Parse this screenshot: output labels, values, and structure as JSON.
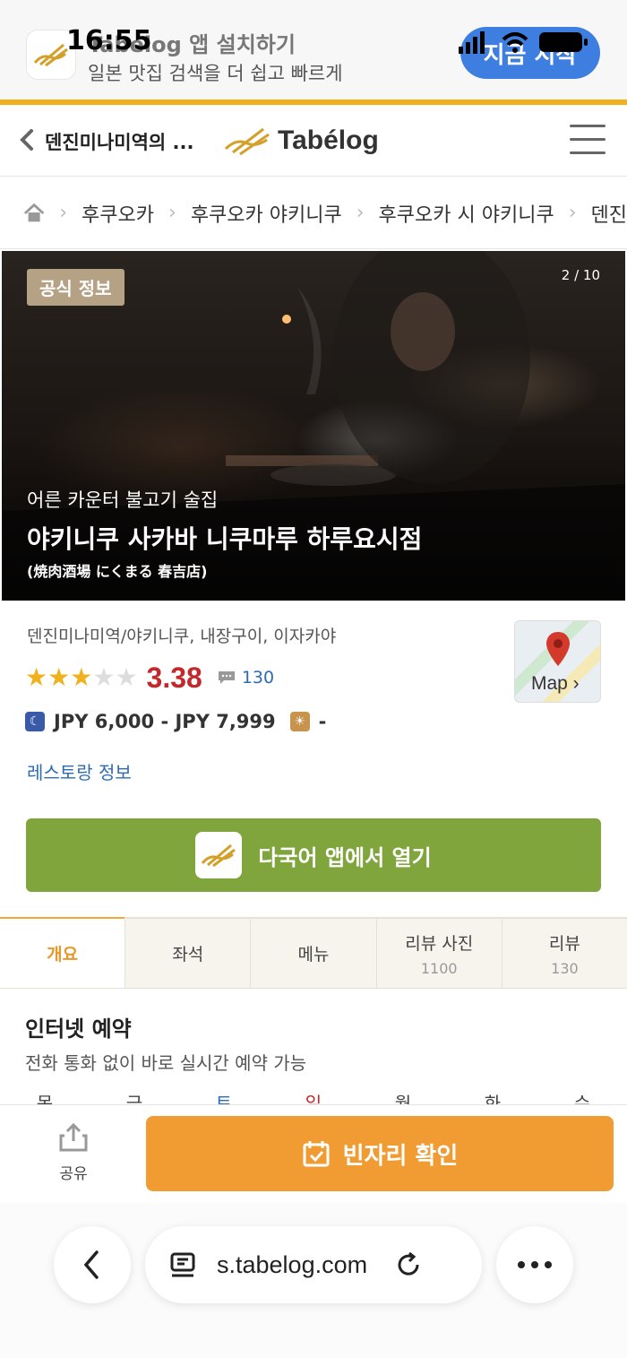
{
  "status_bar": {
    "time": "16:55"
  },
  "app_banner": {
    "title": "Tabelog 앱 설치하기",
    "subtitle": "일본 맛집 검색을 더 쉽고 빠르게",
    "button_label": "지금 시작",
    "accent_color": "#f0b21c"
  },
  "header": {
    "back_label": "덴진미나미역의 ...",
    "logo_text": "Tabélog"
  },
  "breadcrumb": [
    "후쿠오카",
    "후쿠오카 야키니쿠",
    "후쿠오카 시 야키니쿠",
    "덴진"
  ],
  "hero": {
    "badge": "공식 정보",
    "counter": "2 / 10",
    "subtitle": "어른 카운터 불고기 술집",
    "name": "야키니쿠 사카바 니쿠마루 하루요시점",
    "name_jp": "(焼肉酒場 にくまる 春吉店)"
  },
  "restaurant": {
    "genre": "덴진미나미역/야키니쿠, 내장구이, 이자카야",
    "stars_filled": 3,
    "stars_total": 5,
    "score": "3.38",
    "review_count": "130",
    "dinner_price": "JPY 6,000 - JPY 7,999",
    "lunch_price": "-",
    "info_link": "레스토랑 정보",
    "map_label": "Map ›",
    "score_color": "#c2282c"
  },
  "app_cta": {
    "label": "다국어 앱에서 열기",
    "color": "#80a53c"
  },
  "tabs": [
    {
      "label": "개요",
      "count": ""
    },
    {
      "label": "좌석",
      "count": ""
    },
    {
      "label": "메뉴",
      "count": ""
    },
    {
      "label": "리뷰 사진",
      "count": "1100"
    },
    {
      "label": "리뷰",
      "count": "130"
    }
  ],
  "reservation": {
    "title": "인터넷 예약",
    "subtitle": "전화 통화 없이 바로 실시간 예약 가능",
    "weekdays": [
      "목",
      "금",
      "토",
      "일",
      "월",
      "화",
      "수"
    ]
  },
  "bottom_bar": {
    "share_label": "공유",
    "vacancy_label": "빈자리 확인",
    "vacancy_color": "#f09c33"
  },
  "browser": {
    "url": "s.tabelog.com"
  }
}
